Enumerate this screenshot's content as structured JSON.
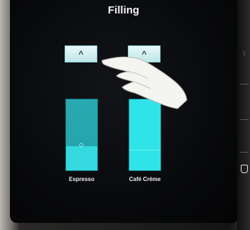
{
  "screen": {
    "title": "Filling"
  },
  "controls": {
    "espresso_up_symbol": "^",
    "creme_up_symbol": "^"
  },
  "tanks": [
    {
      "label": "Espresso",
      "level": 0.34
    },
    {
      "label": "Café Crème",
      "level": 1.0
    }
  ],
  "colors": {
    "button_bg": "#d8f2f3",
    "tank_espresso": "#22a3ac",
    "tank_creme": "#2fe3e8"
  },
  "icons": {
    "side_dots": "⋮",
    "marker": "⬦"
  }
}
